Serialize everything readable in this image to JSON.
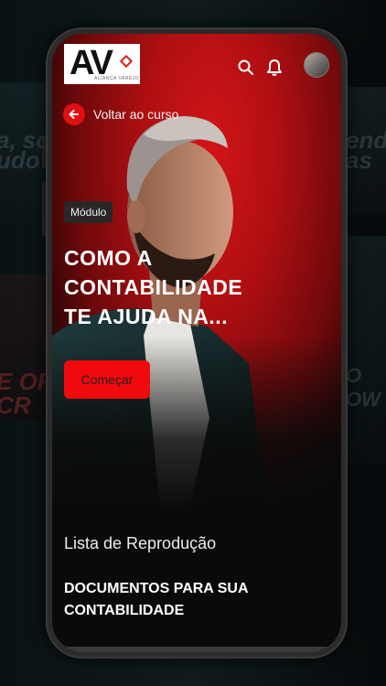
{
  "background": {
    "left_texts": [
      "a, soi",
      "udo Co"
    ],
    "right_texts": [
      "endo",
      "as"
    ],
    "left_lower_text": "E OF\nCR",
    "right_lower_text": "O\nOW"
  },
  "header": {
    "logo_text": "AV",
    "logo_subtext": "ALIANÇA VAREJO",
    "search_icon": "search-icon",
    "bell_icon": "bell-icon",
    "avatar": "user-avatar"
  },
  "hero": {
    "back_label": "Voltar ao curso",
    "badge": "Módulo",
    "title": "COMO A CONTABILIDADE TE AJUDA NA...",
    "start_label": "Começar"
  },
  "playlist": {
    "heading": "Lista de Reprodução",
    "item_title": "DOCUMENTOS PARA SUA CONTABILIDADE"
  },
  "colors": {
    "accent": "#e10e12",
    "hero_red": "#b00f12",
    "dark": "#0a0a0a"
  }
}
